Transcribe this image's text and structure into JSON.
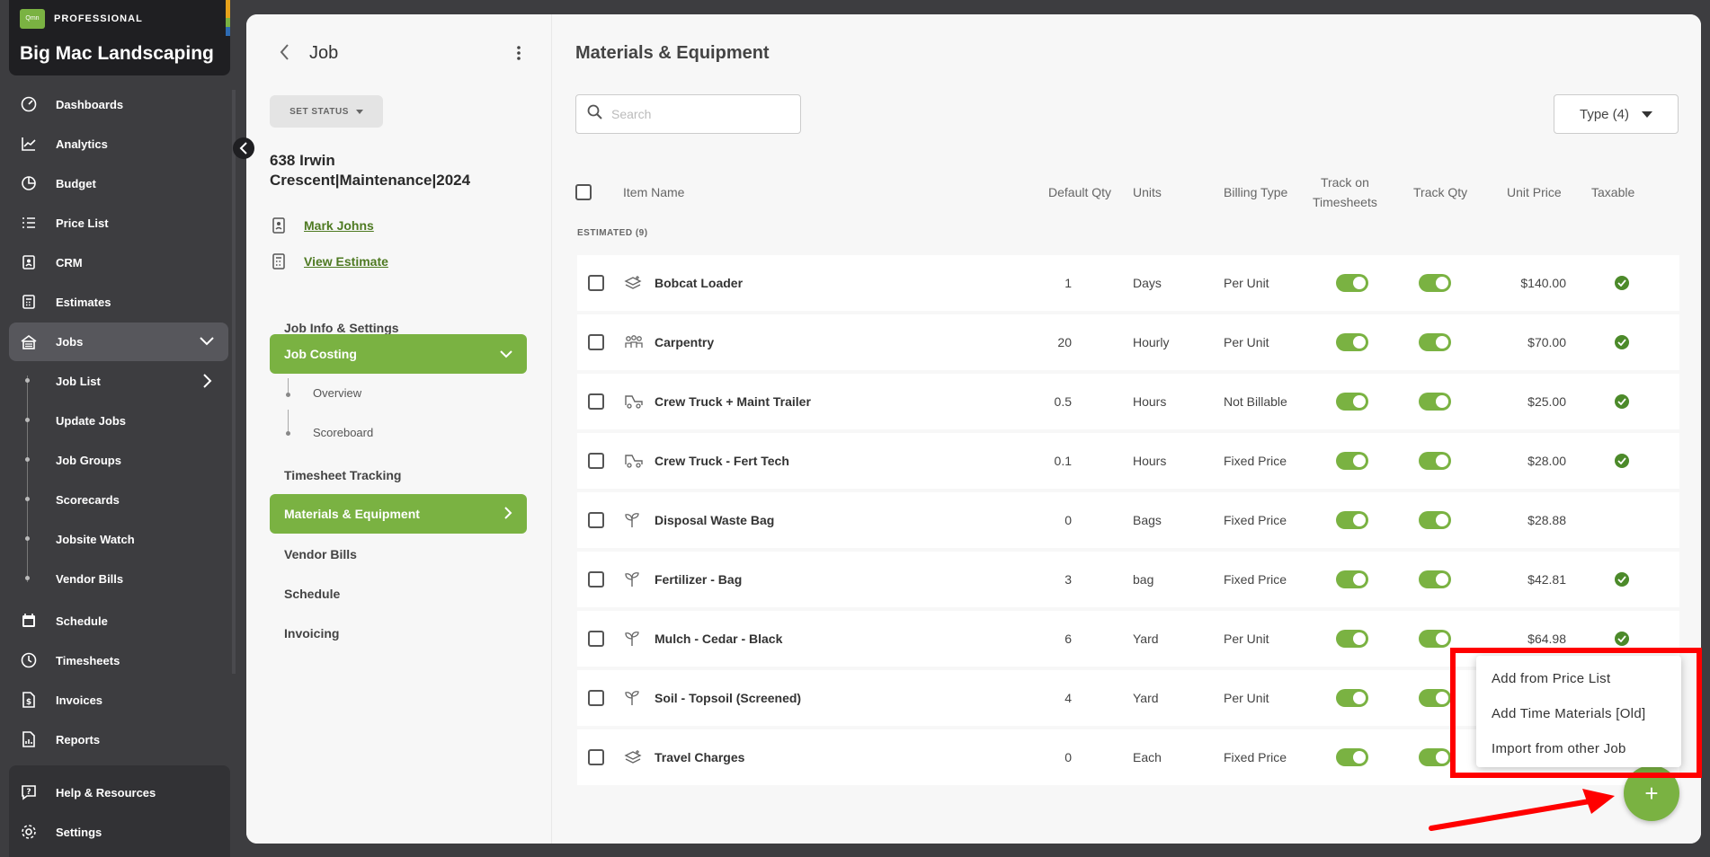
{
  "brand": {
    "logo_text": "Qmn",
    "tier": "PROFESSIONAL",
    "company": "Big Mac Landscaping"
  },
  "sidebar": {
    "items": [
      {
        "label": "Dashboards",
        "icon": "gauge-icon"
      },
      {
        "label": "Analytics",
        "icon": "line-chart-icon"
      },
      {
        "label": "Budget",
        "icon": "pie-chart-icon"
      },
      {
        "label": "Price List",
        "icon": "list-icon"
      },
      {
        "label": "CRM",
        "icon": "contact-card-icon"
      },
      {
        "label": "Estimates",
        "icon": "calculator-icon"
      },
      {
        "label": "Jobs",
        "icon": "jobs-icon"
      }
    ],
    "job_subitems": [
      "Job List",
      "Update Jobs",
      "Job Groups",
      "Scorecards",
      "Jobsite Watch",
      "Vendor Bills"
    ],
    "bottom_items": [
      {
        "label": "Schedule",
        "icon": "calendar-icon"
      },
      {
        "label": "Timesheets",
        "icon": "clock-icon"
      },
      {
        "label": "Invoices",
        "icon": "dollar-doc-icon"
      },
      {
        "label": "Reports",
        "icon": "report-icon"
      }
    ],
    "help_items": [
      {
        "label": "Help & Resources",
        "icon": "help-icon"
      },
      {
        "label": "Settings",
        "icon": "gear-icon"
      }
    ]
  },
  "job": {
    "header": "Job",
    "set_status": "SET STATUS",
    "title": "638 Irwin Crescent|Maintenance|2024",
    "contact": "Mark Johns",
    "view_estimate": "View Estimate",
    "menu": [
      "Job Info & Settings",
      "Job Costing",
      "Timesheet Tracking",
      "Materials & Equipment",
      "Vendor Bills",
      "Schedule",
      "Invoicing"
    ],
    "costing_sub": [
      "Overview",
      "Scoreboard"
    ]
  },
  "content": {
    "title": "Materials & Equipment",
    "search_placeholder": "Search",
    "type_filter": "Type (4)",
    "columns": {
      "item_name": "Item Name",
      "default_qty": "Default Qty",
      "units": "Units",
      "billing_type": "Billing Type",
      "track_on_timesheets_1": "Track on",
      "track_on_timesheets_2": "Timesheets",
      "track_qty": "Track Qty",
      "unit_price": "Unit Price",
      "taxable": "Taxable"
    },
    "group_label": "ESTIMATED (9)",
    "rows": [
      {
        "name": "Bobcat Loader",
        "qty": "1",
        "units": "Days",
        "billing": "Per Unit",
        "price": "$140.00",
        "taxable": true,
        "icon": "equipment-icon"
      },
      {
        "name": "Carpentry",
        "qty": "20",
        "units": "Hourly",
        "billing": "Per Unit",
        "price": "$70.00",
        "taxable": true,
        "icon": "crew-icon"
      },
      {
        "name": "Crew Truck + Maint Trailer",
        "qty": "0.5",
        "units": "Hours",
        "billing": "Not Billable",
        "price": "$25.00",
        "taxable": true,
        "icon": "truck-icon"
      },
      {
        "name": "Crew Truck - Fert Tech",
        "qty": "0.1",
        "units": "Hours",
        "billing": "Fixed Price",
        "price": "$28.00",
        "taxable": true,
        "icon": "truck-icon"
      },
      {
        "name": "Disposal Waste Bag",
        "qty": "0",
        "units": "Bags",
        "billing": "Fixed Price",
        "price": "$28.88",
        "taxable": false,
        "icon": "sprout-icon"
      },
      {
        "name": "Fertilizer - Bag",
        "qty": "3",
        "units": "bag",
        "billing": "Fixed Price",
        "price": "$42.81",
        "taxable": true,
        "icon": "sprout-icon"
      },
      {
        "name": "Mulch - Cedar - Black",
        "qty": "6",
        "units": "Yard",
        "billing": "Per Unit",
        "price": "$64.98",
        "taxable": true,
        "icon": "sprout-icon"
      },
      {
        "name": "Soil - Topsoil (Screened)",
        "qty": "4",
        "units": "Yard",
        "billing": "Per Unit",
        "price": "",
        "taxable": false,
        "icon": "sprout-icon"
      },
      {
        "name": "Travel Charges",
        "qty": "0",
        "units": "Each",
        "billing": "Fixed Price",
        "price": "",
        "taxable": false,
        "icon": "equipment-icon"
      }
    ]
  },
  "popup_menu": [
    "Add from Price List",
    "Add Time Materials [Old]",
    "Import from other Job"
  ],
  "fab_label": "+",
  "colors": {
    "accent": "#7ab242",
    "annotation": "#ff0000"
  }
}
